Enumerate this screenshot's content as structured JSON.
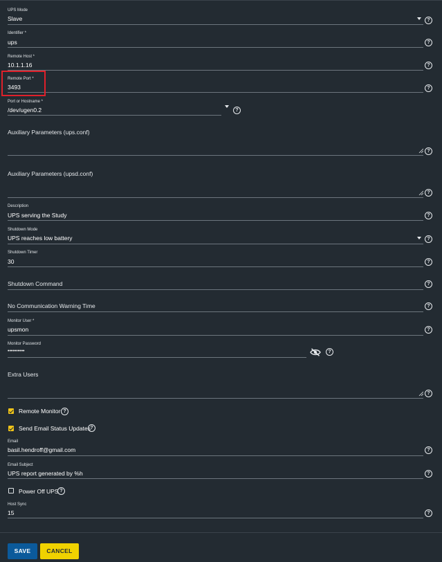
{
  "fields": {
    "ups_mode": {
      "label": "UPS Mode",
      "value": "Slave"
    },
    "identifier": {
      "label": "Identifier *",
      "value": "ups"
    },
    "remote_host": {
      "label": "Remote Host *",
      "value": "10.1.1.16"
    },
    "remote_port": {
      "label": "Remote Port *",
      "value": "3493"
    },
    "port_or_hostname": {
      "label": "Port or Hostname *",
      "value": "/dev/ugen0.2"
    },
    "aux_ups": {
      "label": "Auxiliary Parameters (ups.conf)",
      "value": ""
    },
    "aux_upsd": {
      "label": "Auxiliary Parameters (upsd.conf)",
      "value": ""
    },
    "description": {
      "label": "Description",
      "value": "UPS serving the Study"
    },
    "shutdown_mode": {
      "label": "Shutdown Mode",
      "value": "UPS reaches low battery"
    },
    "shutdown_timer": {
      "label": "Shutdown Timer",
      "value": "30"
    },
    "shutdown_command": {
      "label": "Shutdown Command",
      "value": ""
    },
    "no_comm_warning": {
      "label": "No Communication Warning Time",
      "value": ""
    },
    "monitor_user": {
      "label": "Monitor User *",
      "value": "upsmon"
    },
    "monitor_password": {
      "label": "Monitor Password",
      "value": "••••••••••"
    },
    "extra_users": {
      "label": "Extra Users",
      "value": ""
    },
    "email": {
      "label": "Email",
      "value": "basil.hendroff@gmail.com"
    },
    "email_subject": {
      "label": "Email Subject",
      "value": "UPS report generated by %h"
    },
    "host_sync": {
      "label": "Host Sync",
      "value": "15"
    }
  },
  "checkboxes": {
    "remote_monitor": {
      "label": "Remote Monitor",
      "checked": true
    },
    "send_email": {
      "label": "Send Email Status Updates",
      "checked": true
    },
    "power_off": {
      "label": "Power Off UPS",
      "checked": false
    }
  },
  "buttons": {
    "save": "SAVE",
    "cancel": "CANCEL"
  },
  "icons": {
    "help": "help-circle-icon",
    "caret": "dropdown-caret-icon",
    "eye": "eye-off-icon",
    "resize": "resize-handle-icon"
  },
  "colors": {
    "background": "#232b32",
    "accent_yellow": "#f0c419",
    "save_blue": "#0b5a9b",
    "highlight_red": "#e0202a"
  }
}
